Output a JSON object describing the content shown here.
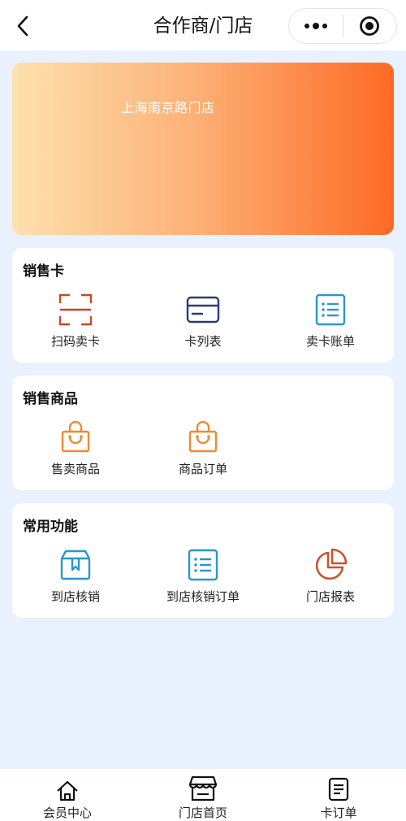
{
  "navbar": {
    "title": "合作商/门店",
    "back_icon": "chevron-left-icon",
    "more_icon": "more-dots-icon",
    "close_icon": "target-circle-icon"
  },
  "banner": {
    "store_name": "上海南京路门店"
  },
  "sections": [
    {
      "title": "销售卡",
      "items": [
        {
          "label": "扫码卖卡",
          "icon": "scan-icon",
          "color": "#c8472c"
        },
        {
          "label": "卡列表",
          "icon": "card-icon",
          "color": "#2c3a78"
        },
        {
          "label": "卖卡账单",
          "icon": "list-doc-icon",
          "color": "#2a97c9"
        }
      ]
    },
    {
      "title": "销售商品",
      "items": [
        {
          "label": "售卖商品",
          "icon": "shopping-bag-icon",
          "color": "#ef8a2a"
        },
        {
          "label": "商品订单",
          "icon": "shopping-bag-icon",
          "color": "#ef8a2a"
        }
      ]
    },
    {
      "title": "常用功能",
      "items": [
        {
          "label": "到店核销",
          "icon": "box-bookmark-icon",
          "color": "#2a97c9"
        },
        {
          "label": "到店核销订单",
          "icon": "list-doc-icon",
          "color": "#2a97c9"
        },
        {
          "label": "门店报表",
          "icon": "pie-chart-icon",
          "color": "#c8552c"
        }
      ]
    }
  ],
  "tabbar": {
    "items": [
      {
        "label": "会员中心",
        "icon": "home-icon"
      },
      {
        "label": "门店首页",
        "icon": "store-icon"
      },
      {
        "label": "卡订单",
        "icon": "document-icon"
      }
    ]
  }
}
